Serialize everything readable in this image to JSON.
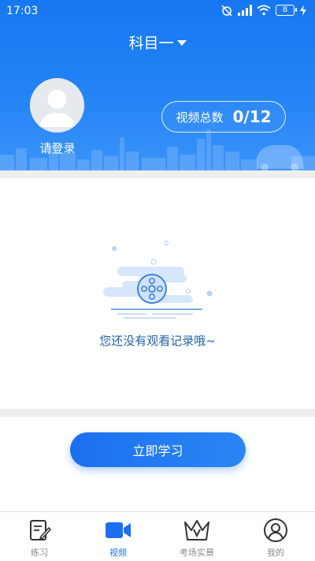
{
  "status_bar": {
    "time": "17:03",
    "battery": "8"
  },
  "header": {
    "subject": "科目一",
    "login_label": "请登录",
    "video_count_label": "视频总数",
    "video_count_value": "0/12"
  },
  "empty_state": {
    "message": "您还没有观看记录哦~"
  },
  "actions": {
    "study_button": "立即学习"
  },
  "tabbar": {
    "items": [
      {
        "label": "练习",
        "icon": "notebook-pen-icon",
        "active": false
      },
      {
        "label": "视频",
        "icon": "video-camera-icon",
        "active": true
      },
      {
        "label": "考场实景",
        "icon": "crown-icon",
        "active": false
      },
      {
        "label": "我的",
        "icon": "user-profile-icon",
        "active": false
      }
    ]
  },
  "colors": {
    "primary": "#1c6ff0",
    "header_gradient_top": "#1677f2",
    "empty_text": "#2363a8",
    "tab_inactive": "#8a8a8a",
    "band_gray": "#eeeeee"
  }
}
